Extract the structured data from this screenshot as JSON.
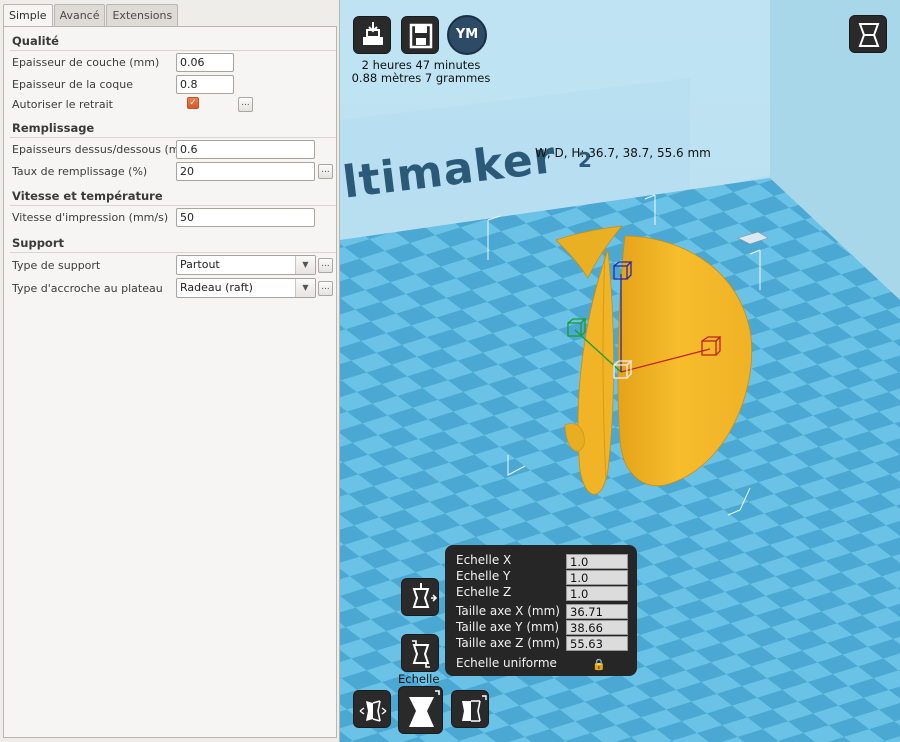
{
  "tabs": [
    {
      "label": "Simple",
      "active": true
    },
    {
      "label": "Avancé",
      "active": false
    },
    {
      "label": "Extensions",
      "active": false
    }
  ],
  "sections": {
    "quality": "Qualité",
    "fill": "Remplissage",
    "speed": "Vitesse et température",
    "support": "Support"
  },
  "settings": {
    "layer_height": {
      "label": "Epaisseur de couche (mm)",
      "value": "0.06"
    },
    "shell_thickness": {
      "label": "Epaisseur de la coque",
      "value": "0.8"
    },
    "retraction": {
      "label": "Autoriser le retrait",
      "checked": true,
      "more": "..."
    },
    "top_bottom": {
      "label": "Epaisseurs dessus/dessous (mm)",
      "value": "0.6"
    },
    "fill_density": {
      "label": "Taux de remplissage (%)",
      "value": "20",
      "more": "..."
    },
    "print_speed": {
      "label": "Vitesse d'impression (mm/s)",
      "value": "50"
    },
    "support_type": {
      "label": "Type de support",
      "value": "Partout",
      "more": "..."
    },
    "adhesion": {
      "label": "Type d'accroche au plateau",
      "value": "Radeau (raft)",
      "more": "..."
    }
  },
  "viewport": {
    "print_time": "2 heures 47 minutes",
    "material": "0.88 mètres 7 grammes",
    "ym_label": "YM",
    "dimensions": "W, D, H: 36.7, 38.7, 55.6 mm",
    "brand": "ltimaker",
    "brand_sup": "2",
    "scale_label": "Echelle"
  },
  "scale_panel": {
    "rows": [
      {
        "label": "Echelle X",
        "value": "1.0"
      },
      {
        "label": "Echelle Y",
        "value": "1.0"
      },
      {
        "label": "Echelle Z",
        "value": "1.0"
      },
      {
        "label": "Taille axe X (mm)",
        "value": "36.71"
      },
      {
        "label": "Taille axe Y (mm)",
        "value": "38.66"
      },
      {
        "label": "Taille axe Z (mm)",
        "value": "55.63"
      }
    ],
    "uniform_label": "Echelle uniforme",
    "lock_glyph": "🔒"
  },
  "colors": {
    "panel_bg": "#efedea",
    "floor_light": "#6ac3e6",
    "floor_dark": "#3e9cc7",
    "wall": "#a7d6ea",
    "model": "#f3b728",
    "check": "#e2652f"
  }
}
